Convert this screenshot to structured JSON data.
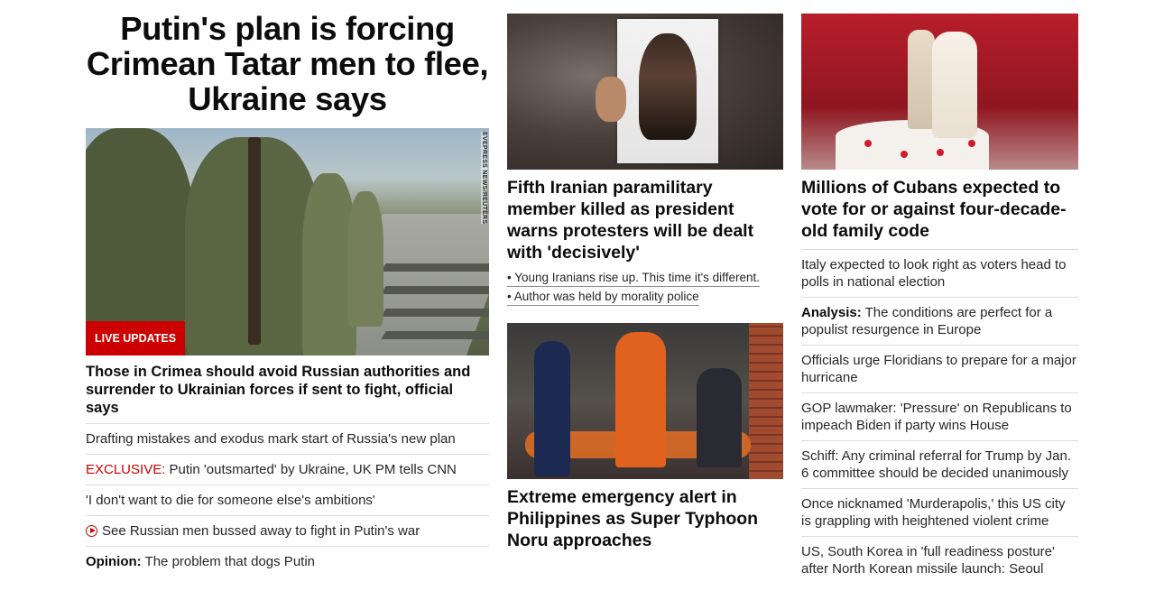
{
  "main": {
    "headline": "Putin's plan is forcing Crimean Tatar men to flee, Ukraine says",
    "photo_credit": "EVEPRESS NEWS/REUTERS",
    "badge": "LIVE UPDATES",
    "subheadline": "Those in Crimea should avoid Russian authorities and surrender to Ukrainian forces if sent to fight, official says",
    "links": [
      {
        "prefix": "",
        "text": "Drafting mistakes and exodus mark start of Russia's new plan"
      },
      {
        "prefix": "EXCLUSIVE:",
        "text": " Putin 'outsmarted' by Ukraine, UK PM tells CNN"
      },
      {
        "prefix": "",
        "text": "'I don't want to die for someone else's ambitions'"
      },
      {
        "prefix": "",
        "text": "See Russian men bussed away to fight in Putin's war",
        "icon": "play-icon"
      },
      {
        "prefix": "Opinion:",
        "text": " The problem that dogs Putin"
      }
    ]
  },
  "middle": {
    "story1": {
      "title": "Fifth Iranian paramilitary member killed as president warns protesters will be dealt with 'decisively'",
      "bullets": [
        "• Young Iranians rise up. This time it's different.",
        "• Author was held by morality police"
      ]
    },
    "story2": {
      "title": "Extreme emergency alert in Philippines as Super Typhoon Noru approaches"
    }
  },
  "right": {
    "title": "Millions of Cubans expected to vote for or against four-decade-old family code",
    "links": [
      {
        "prefix": "",
        "text": "Italy expected to look right as voters head to polls in national election"
      },
      {
        "prefix": "Analysis:",
        "text": " The conditions are perfect for a populist resurgence in Europe"
      },
      {
        "prefix": "",
        "text": "Officials urge Floridians to prepare for a major hurricane"
      },
      {
        "prefix": "",
        "text": "GOP lawmaker: 'Pressure' on Republicans to impeach Biden if party wins House"
      },
      {
        "prefix": "",
        "text": "Schiff: Any criminal referral for Trump by Jan. 6 committee should be decided unanimously"
      },
      {
        "prefix": "",
        "text": "Once nicknamed 'Murderapolis,' this US city is grappling with heightened violent crime"
      },
      {
        "prefix": "",
        "text": "US, South Korea in 'full readiness posture' after North Korean missile launch: Seoul"
      }
    ]
  },
  "colors": {
    "accent_red": "#cc0000",
    "text": "#0c0c0c",
    "divider": "#dcdcdc"
  }
}
